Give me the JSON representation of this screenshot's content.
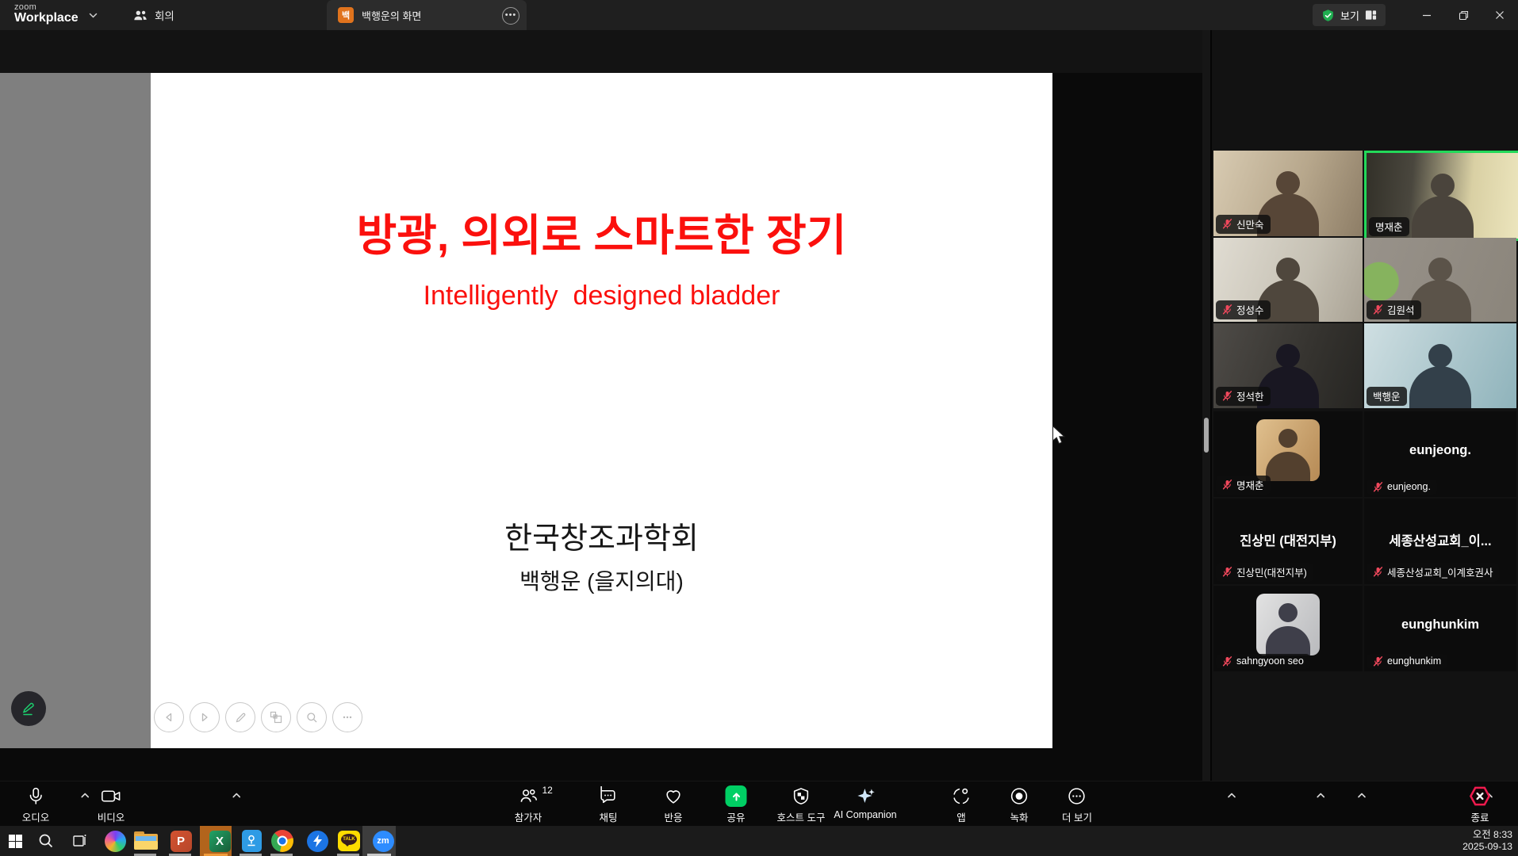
{
  "titlebar": {
    "brand_top": "zoom",
    "brand_bottom": "Workplace",
    "meeting_tab": "회의",
    "screen_tab": "백행운의 화면",
    "screen_tab_badge": "백",
    "view_label": "보기"
  },
  "slide": {
    "title": "방광, 의외로 스마트한 장기",
    "subtitle": "Intelligently  designed bladder",
    "org": "한국창조과학회",
    "presenter": "백행운 (을지의대)"
  },
  "participants": {
    "videos": [
      {
        "name": "신만숙",
        "muted": true,
        "active": false
      },
      {
        "name": "명재춘",
        "muted": false,
        "active": true
      },
      {
        "name": "정성수",
        "muted": true,
        "active": false
      },
      {
        "name": "김원석",
        "muted": true,
        "active": false
      },
      {
        "name": "정석한",
        "muted": true,
        "active": false
      },
      {
        "name": "백행운",
        "muted": false,
        "active": false
      }
    ],
    "audio_only": [
      {
        "display": "",
        "plate": "명재춘",
        "muted": true,
        "avatar": true
      },
      {
        "display": "eunjeong.",
        "plate": "eunjeong.",
        "muted": true,
        "avatar": false
      },
      {
        "display": "진상민 (대전지부)",
        "plate": "진상민(대전지부)",
        "muted": true,
        "avatar": false
      },
      {
        "display": "세종산성교회_이...",
        "plate": "세종산성교회_이계호권사",
        "muted": true,
        "avatar": false
      },
      {
        "display": "",
        "plate": "sahngyoon seo",
        "muted": true,
        "avatar": true
      },
      {
        "display": "eunghunkim",
        "plate": "eunghunkim",
        "muted": true,
        "avatar": false
      }
    ]
  },
  "toolbar": {
    "audio": "오디오",
    "video": "비디오",
    "participants": "참가자",
    "participants_count": "12",
    "chat": "채팅",
    "reactions": "반응",
    "share": "공유",
    "host_tools": "호스트 도구",
    "ai_companion": "AI Companion",
    "apps": "앱",
    "record": "녹화",
    "more": "더 보기",
    "end": "종료"
  },
  "taskbar": {
    "clock_time": "오전 8:33",
    "clock_date": "2025-09-13",
    "apps": [
      "start",
      "search",
      "task-view",
      "copilot",
      "file-explorer",
      "powerpoint",
      "excel",
      "viewer",
      "chrome",
      "bolt-app",
      "kakaotalk",
      "zoom"
    ],
    "excel_glyph": "X",
    "powerpoint_glyph": "P",
    "kakao_glyph": "TALK",
    "zoom_glyph": "zm"
  },
  "icons": {
    "share": "green-square-up-arrow",
    "record": "dot-in-circle",
    "more": "ellipsis-in-circle",
    "end": "red-hexagon-x",
    "mute": "red-mic-slash",
    "ai_companion": "sparkle-star",
    "host_tools": "shield",
    "view_security": "green-shield-check"
  },
  "colors": {
    "accent_green": "#00cf64",
    "active_speaker_border": "#23d959",
    "end_red": "#ef1a4e",
    "mute_red": "#f0485c",
    "slide_title_red": "#fb100d",
    "tab_badge_orange": "#e0731d",
    "excel_highlight": "#b2641c"
  }
}
